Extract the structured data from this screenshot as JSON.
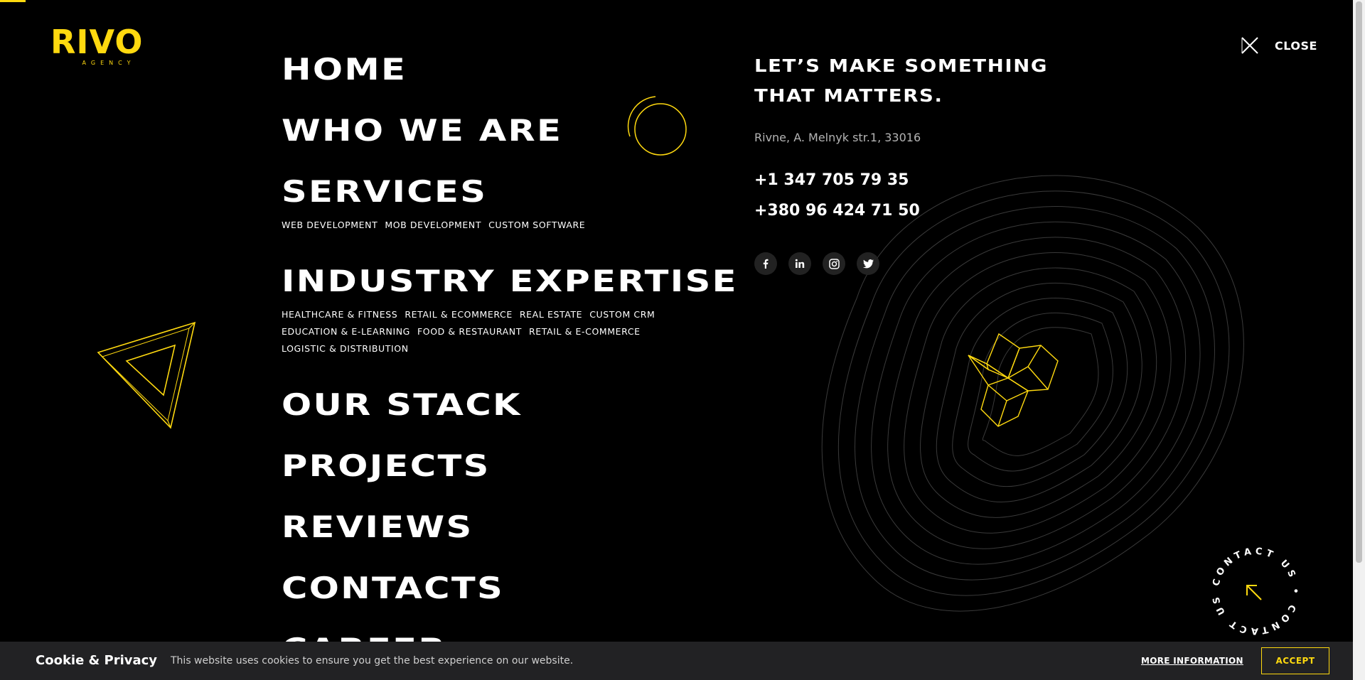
{
  "brand": {
    "logo_text": "RIVO",
    "logo_sub": "AGENCY",
    "accent": "#ffd90f"
  },
  "header": {
    "close_label": "CLOSE",
    "close_icon": "close-x-icon"
  },
  "nav": {
    "home": "HOME",
    "who": "WHO WE ARE",
    "services": "SERVICES",
    "services_sub": [
      "WEB DEVELOPMENT",
      "MOB DEVELOPMENT",
      "CUSTOM SOFTWARE"
    ],
    "industry": "INDUSTRY EXPERTISE",
    "industry_sub": [
      "HEALTHCARE & FITNESS",
      "RETAIL & ECOMMERCE",
      "REAL ESTATE",
      "CUSTOM CRM",
      "EDUCATION & E-LEARNING",
      "FOOD & RESTAURANT",
      "RETAIL & E-COMMERCE",
      "LOGISTIC & DISTRIBUTION"
    ],
    "stack": "OUR STACK",
    "projects": "PROJECTS",
    "reviews": "REVIEWS",
    "contacts": "CONTACTS",
    "career": "CAREER"
  },
  "contact": {
    "heading": "LET’S MAKE SOMETHING THAT MATTERS.",
    "address": "Rivne, A. Melnyk str.1, 33016",
    "phone_1": "+1 347 705 79 35",
    "phone_2": "+380 96 424 71 50",
    "socials": [
      "facebook-icon",
      "linkedin-icon",
      "instagram-icon",
      "twitter-icon"
    ]
  },
  "contact_badge": {
    "text": "CONTACT US • CONTACT US •",
    "icon": "arrow-up-left-icon"
  },
  "cookie": {
    "title": "Cookie & Privacy",
    "text": "This website uses cookies to ensure you get the best experience on our website.",
    "more": "MORE INFORMATION",
    "accept": "ACCEPT"
  }
}
